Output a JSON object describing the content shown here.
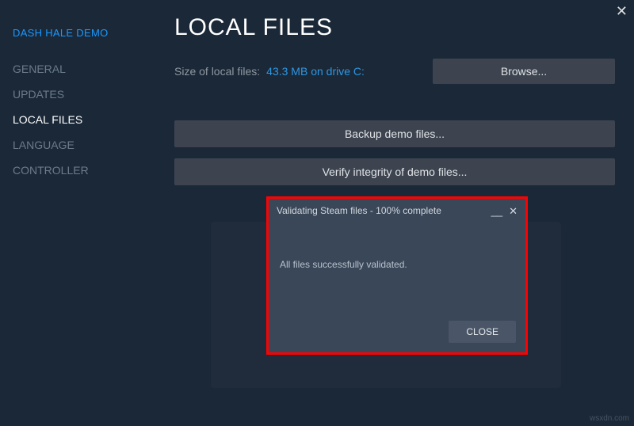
{
  "app_title": "DASH HALE DEMO",
  "sidebar": {
    "items": [
      {
        "label": "GENERAL"
      },
      {
        "label": "UPDATES"
      },
      {
        "label": "LOCAL FILES"
      },
      {
        "label": "LANGUAGE"
      },
      {
        "label": "CONTROLLER"
      }
    ],
    "active_index": 2
  },
  "main": {
    "title": "LOCAL FILES",
    "size_label": "Size of local files:",
    "size_value": "43.3 MB on drive C:",
    "browse_label": "Browse...",
    "backup_label": "Backup demo files...",
    "verify_label": "Verify integrity of demo files..."
  },
  "dialog": {
    "title": "Validating Steam files - 100% complete",
    "body": "All files successfully validated.",
    "close_label": "CLOSE"
  },
  "watermark": "wsxdn.com"
}
